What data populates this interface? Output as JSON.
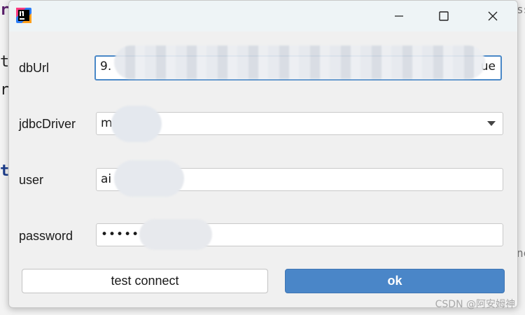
{
  "background_fragments": {
    "f1": "r",
    "f2": "t",
    "f3": "r",
    "f4": "t",
    "f5": "ss",
    "f6": "ne"
  },
  "window": {
    "buttons": {
      "minimize_icon": "minimize-icon",
      "maximize_icon": "maximize-icon",
      "close_icon": "close-icon"
    }
  },
  "form": {
    "dburl": {
      "label": "dbUrl",
      "value_start": "9.",
      "value_end": "ue"
    },
    "jdbc_driver": {
      "label": "jdbcDriver",
      "value_start": "m"
    },
    "user": {
      "label": "user",
      "value_start": "ai"
    },
    "password": {
      "label": "password",
      "value_start": "••••••"
    }
  },
  "buttons": {
    "test_connect": "test connect",
    "ok": "ok"
  },
  "watermark": "CSDN @阿安姆神",
  "colors": {
    "accent": "#4a86c8",
    "focus_border": "#4a88c7",
    "titlebar": "#eef4f6"
  }
}
